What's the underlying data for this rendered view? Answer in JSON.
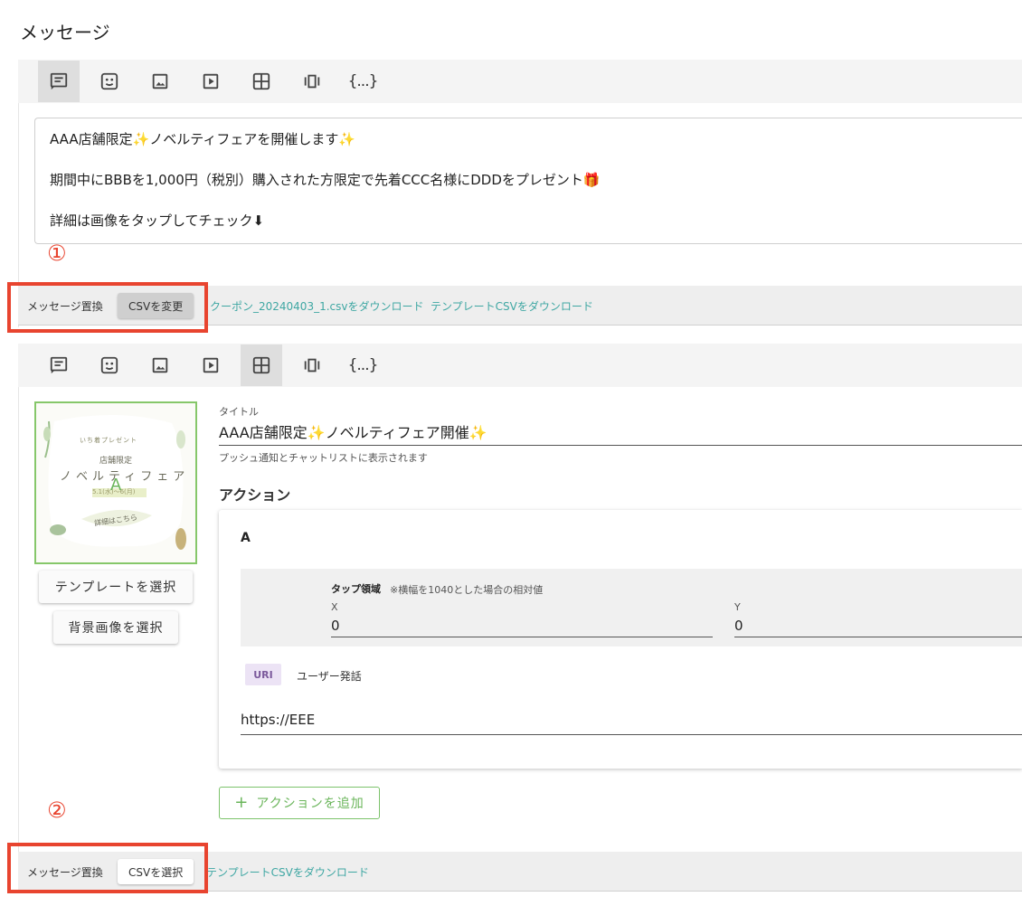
{
  "page": {
    "title": "メッセージ"
  },
  "toolbar": {
    "items": [
      {
        "icon": "text-icon"
      },
      {
        "icon": "sticker-icon"
      },
      {
        "icon": "image-icon"
      },
      {
        "icon": "video-icon"
      },
      {
        "icon": "imagemap-icon"
      },
      {
        "icon": "carousel-icon"
      },
      {
        "icon": "flex-icon",
        "label": "{...}"
      }
    ]
  },
  "message1": {
    "lines": [
      "AAA店舗限定✨ノベルティフェアを開催します✨",
      "期間中にBBBを1,000円（税別）購入された方限定で先着CCC名様にDDDをプレゼント🎁",
      "詳細は画像をタップしてチェック⬇"
    ],
    "marker": "①"
  },
  "replace1": {
    "label": "メッセージ置換",
    "button": "CSVを変更",
    "link1": "クーポン_20240403_1.csvをダウンロード",
    "link2": "テンプレートCSVをダウンロード"
  },
  "imagemap": {
    "thumb": {
      "line1": "いち着プレゼント",
      "line2": "店舗限定",
      "line3": "ノベルティフェア",
      "dates": "5.1(水)〜6(月)",
      "button": "詳細はこちら",
      "area_label": "A"
    },
    "template_button": "テンプレートを選択",
    "background_button": "背景画像を選択",
    "title_label": "タイトル",
    "title_value": "AAA店舗限定✨ノベルティフェア開催✨",
    "title_hint": "プッシュ通知とチャットリストに表示されます",
    "section_heading": "アクション",
    "action": {
      "name": "A",
      "tap_area_label": "タップ領域",
      "tap_area_note": "※横幅を1040とした場合の相対値",
      "x_label": "X",
      "x_value": "0",
      "y_label": "Y",
      "y_value": "0",
      "type_uri": "URI",
      "type_message": "ユーザー発話",
      "uri_value": "https://EEE"
    },
    "add_action": "アクションを追加",
    "marker": "②"
  },
  "replace2": {
    "label": "メッセージ置換",
    "button": "CSVを選択",
    "link1": "テンプレートCSVをダウンロード"
  },
  "colors": {
    "highlight": "#e8442f",
    "link": "#3fa7a3",
    "accent_green": "#7cc36b"
  }
}
